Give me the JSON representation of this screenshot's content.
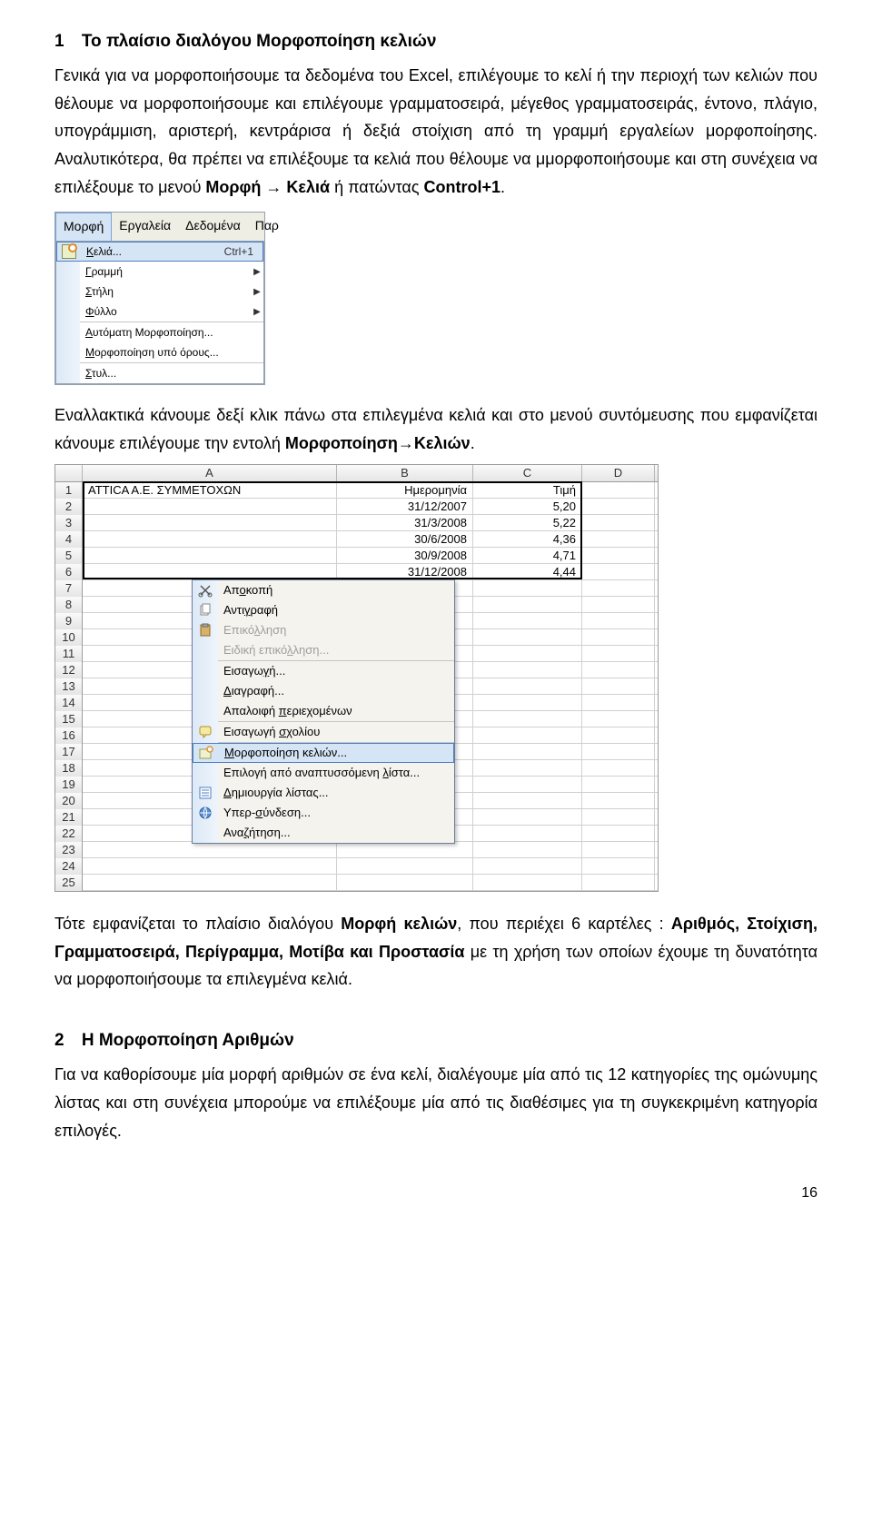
{
  "section1": {
    "num": "1",
    "title": "Το πλαίσιο διαλόγου Μορφοποίηση κελιών",
    "para": "Γενικά για να μορφοποιήσουμε τα δεδομένα του Excel, επιλέγουμε το κελί ή την περιοχή των κελιών που θέλουμε να μορφοποιήσουμε και επιλέγουμε γραμματοσειρά, μέγεθος γραμματοσειράς, έντονο, πλάγιο, υπογράμμιση, αριστερή, κεντράρισα ή δεξιά στοίχιση από τη γραμμή εργαλείων μορφοποίησης. Αναλυτικότερα, θα πρέπει να επιλέξουμε τα κελιά που θέλουμε να μμορφοποιήσουμε και στη συνέχεια να επιλέξουμε το μενού ",
    "menu_bold": "Μορφή → Κελιά",
    "para_tail": " ή πατώντας ",
    "ctrl1": "Control+1",
    "dot": "."
  },
  "menu1": {
    "tabs": [
      "Μορφή",
      "Εργαλεία",
      "Δεδομένα",
      "Παρ"
    ],
    "items": [
      {
        "label": "Κελιά...",
        "shortcut": "Ctrl+1",
        "icon": "cells",
        "highlight": true
      },
      {
        "label": "Γραμμή",
        "submenu": true
      },
      {
        "label": "Στήλη",
        "submenu": true
      },
      {
        "label": "Φύλλο",
        "submenu": true
      },
      {
        "sep": true
      },
      {
        "label": "Αυτόματη Μορφοποίηση..."
      },
      {
        "label": "Μορφοποίηση υπό όρους..."
      },
      {
        "sep": true
      },
      {
        "label": "Στυλ..."
      }
    ]
  },
  "mid": {
    "para_a": "Εναλλακτικά κάνουμε δεξί κλικ πάνω στα επιλεγμένα κελιά και στο μενού συντόμευσης που εμφανίζεται κάνουμε επιλέγουμε την εντολή ",
    "bold": "Μορφοποίηση→Κελιών",
    "dot": "."
  },
  "spreadsheet": {
    "columns": [
      "A",
      "B",
      "C",
      "D"
    ],
    "rows": [
      {
        "n": "1",
        "A": "ATTICA A.E. ΣΥΜΜΕΤΟΧΩΝ",
        "B": "Ημερομηνία",
        "C": "Τιμή"
      },
      {
        "n": "2",
        "A": "",
        "B": "31/12/2007",
        "C": "5,20"
      },
      {
        "n": "3",
        "A": "",
        "B": "31/3/2008",
        "C": "5,22"
      },
      {
        "n": "4",
        "A": "",
        "B": "30/6/2008",
        "C": "4,36"
      },
      {
        "n": "5",
        "A": "",
        "B": "30/9/2008",
        "C": "4,71"
      },
      {
        "n": "6",
        "A": "",
        "B": "31/12/2008",
        "C": "4,44"
      },
      {
        "n": "7"
      },
      {
        "n": "8"
      },
      {
        "n": "9"
      },
      {
        "n": "10"
      },
      {
        "n": "11"
      },
      {
        "n": "12"
      },
      {
        "n": "13"
      },
      {
        "n": "14"
      },
      {
        "n": "15"
      },
      {
        "n": "16"
      },
      {
        "n": "17"
      },
      {
        "n": "18"
      },
      {
        "n": "19"
      },
      {
        "n": "20"
      },
      {
        "n": "21"
      },
      {
        "n": "22"
      },
      {
        "n": "23"
      },
      {
        "n": "24"
      },
      {
        "n": "25"
      }
    ],
    "ctx": [
      {
        "label": "Αποκοπή",
        "icon": "cut",
        "u": 2
      },
      {
        "label": "Αντιγραφή",
        "icon": "copy",
        "u": 4
      },
      {
        "label": "Επικόλληση",
        "icon": "paste",
        "disabled": true,
        "u": 5
      },
      {
        "label": "Ειδική επικόλληση...",
        "disabled": true,
        "u": 12
      },
      {
        "sep": true
      },
      {
        "label": "Εισαγωγή...",
        "u": 6
      },
      {
        "label": "Διαγραφή...",
        "u": 0
      },
      {
        "label": "Απαλοιφή περιεχομένων",
        "u": 9
      },
      {
        "sep": true
      },
      {
        "label": "Εισαγωγή σχολίου",
        "icon": "comment",
        "u": 9
      },
      {
        "sep": true
      },
      {
        "label": "Μορφοποίηση κελιών...",
        "icon": "cells",
        "highlight": true,
        "u": 0
      },
      {
        "label": "Επιλογή από αναπτυσσόμενη λίστα...",
        "u": 26
      },
      {
        "label": "Δημιουργία λίστας...",
        "icon": "list",
        "u": 0
      },
      {
        "label": "Υπερ-σύνδεση...",
        "icon": "link",
        "u": 5
      },
      {
        "label": "Αναζήτηση...",
        "u": 3
      }
    ]
  },
  "after": {
    "p1_a": "Τότε εμφανίζεται το πλαίσιο διαλόγου ",
    "p1_b": "Μορφή κελιών",
    "p1_c": ", που περιέχει 6 καρτέλες : ",
    "p2_bold": "Αριθμός, Στοίχιση, Γραμματοσειρά, Περίγραμμα, Μοτίβα και Προστασία",
    "p2_tail": " με τη χρήση των οποίων έχουμε τη δυνατότητα να μορφοποιήσουμε τα επιλεγμένα κελιά."
  },
  "section2": {
    "num": "2",
    "title": "Η Μορφοποίηση Αριθμών",
    "para": "Για να καθορίσουμε μία μορφή αριθμών σε ένα κελί, διαλέγουμε μία από τις 12 κατηγορίες της ομώνυμης λίστας και στη συνέχεια μπορούμε να επιλέξουμε μία από τις διαθέσιμες για τη συγκεκριμένη κατηγορία επιλογές."
  },
  "pagenum": "16"
}
